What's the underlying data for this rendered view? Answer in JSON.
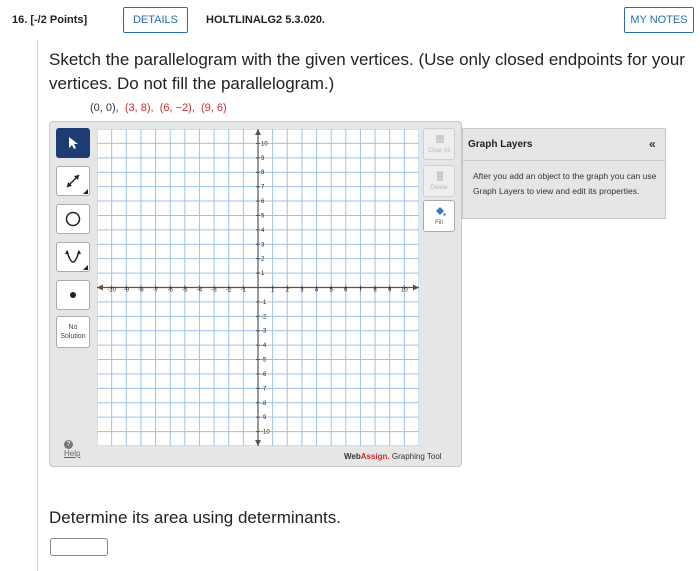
{
  "header": {
    "question_number": "16.",
    "points": "[-/2 Points]",
    "details_label": "DETAILS",
    "problem_code": "HOLTLINALG2 5.3.020.",
    "notes_label": "MY NOTES"
  },
  "prompt": "Sketch the parallelogram with the given vertices. (Use only closed endpoints for your vertices. Do not fill the parallelogram.)",
  "vertices": {
    "v1": "(0, 0),",
    "v2": "(3, 8),",
    "v3": "(6, −2),",
    "v4": "(9, 6)"
  },
  "graph": {
    "x_ticks": [
      "-10",
      "-9",
      "-8",
      "-7",
      "-6",
      "-5",
      "-4",
      "-3",
      "-2",
      "-1",
      "1",
      "2",
      "3",
      "4",
      "5",
      "6",
      "7",
      "8",
      "9",
      "10"
    ],
    "y_ticks": [
      "10",
      "9",
      "8",
      "7",
      "6",
      "5",
      "4",
      "3",
      "2",
      "1",
      "-1",
      "-2",
      "-3",
      "-4",
      "-5",
      "-6",
      "-7",
      "-8",
      "-9",
      "-10"
    ],
    "xlim": [
      -11,
      11
    ],
    "ylim": [
      -11,
      11
    ],
    "grid": true
  },
  "tools": {
    "no_solution": "No Solution",
    "help": "Help",
    "clear_all": "Clear All",
    "delete": "Delete",
    "fill": "Fill"
  },
  "layers": {
    "title": "Graph Layers",
    "collapse": "«",
    "description": "After you add an object to the graph you can use Graph Layers to view and edit its properties."
  },
  "brand": {
    "web": "Web",
    "assign": "Assign.",
    "suffix": " Graphing Tool"
  },
  "area_question": "Determine its area using determinants.",
  "answer": {
    "value": "",
    "placeholder": ""
  }
}
